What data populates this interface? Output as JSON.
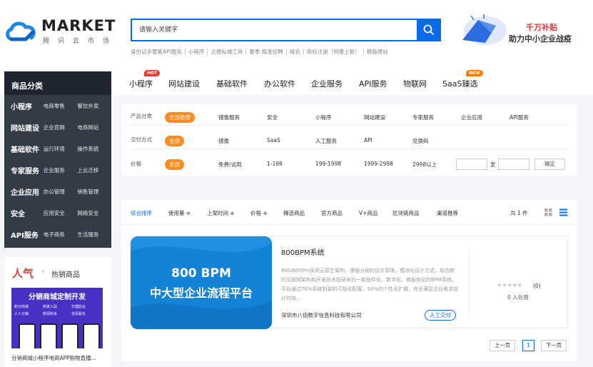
{
  "logo": {
    "main": "MARKET",
    "sub": "腾讯云市场"
  },
  "search": {
    "placeholder": "请输入关键字",
    "value": ""
  },
  "hotkeys": [
    "身份证多要素API服务",
    "小程序",
    "企微私域工具",
    "春季·精准招聘",
    "域名",
    "商标注册（特惠上新）",
    "模版建站"
  ],
  "promo": {
    "line1": "千万补贴",
    "line2": "助力中小企业战疫"
  },
  "nav": {
    "items": [
      {
        "label": "小程序",
        "badge": "HOT"
      },
      {
        "label": "网站建设",
        "badge": ""
      },
      {
        "label": "基础软件",
        "badge": ""
      },
      {
        "label": "办公软件",
        "badge": ""
      },
      {
        "label": "企业服务",
        "badge": ""
      },
      {
        "label": "API服务",
        "badge": ""
      },
      {
        "label": "物联网",
        "badge": ""
      },
      {
        "label": "SaaS臻选",
        "badge": "NEW"
      }
    ]
  },
  "sidebar": {
    "title": "商品分类",
    "rows": [
      {
        "cat": "小程序",
        "sub1": "电商零售",
        "sub2": "餐饮外卖"
      },
      {
        "cat": "网站建设",
        "sub1": "企业官网",
        "sub2": "电商网站"
      },
      {
        "cat": "基础软件",
        "sub1": "运行环境",
        "sub2": "操作系统"
      },
      {
        "cat": "专家服务",
        "sub1": "企业服务",
        "sub2": "上云迁移"
      },
      {
        "cat": "企业应用",
        "sub1": "办公管理",
        "sub2": "销售管理"
      },
      {
        "cat": "安全",
        "sub1": "应用安全",
        "sub2": "网络安全"
      },
      {
        "cat": "API服务",
        "sub1": "电子商务",
        "sub2": "生活服务"
      }
    ]
  },
  "hot": {
    "title": "人气",
    "sep": "·",
    "subtitle": "热销商品",
    "banner_title": "分销商城定制开发",
    "banner_tags": [
      "积分商城",
      "商家入驻",
      "代理后台",
      "人人分销",
      "拼团秒杀",
      "全民股东"
    ],
    "caption": "分销商城小程序电商APP购物直播..."
  },
  "filter": {
    "rows": [
      {
        "label": "产品分类",
        "active": "全部类型",
        "options": [
          "镜像服务",
          "安全",
          "小程序",
          "网站建设",
          "专家服务",
          "企业应用",
          "API服务"
        ]
      },
      {
        "label": "交付方式",
        "active": "全部",
        "options": [
          "镜像",
          "SaaS",
          "人工服务",
          "API",
          "兑换码"
        ]
      },
      {
        "label": "价格",
        "active": "全部",
        "options": [
          "免费/试用",
          "1-198",
          "199-1998",
          "1999-2998",
          "2998以上"
        ]
      }
    ],
    "price_to": "至",
    "confirm": "确定"
  },
  "sort": {
    "items": [
      "综合排序",
      "使用量 ≑",
      "上架时间 ≑",
      "价格 ≑",
      "臻选商品",
      "官方商品",
      "V+商品",
      "区块链商品",
      "渠道推荐"
    ],
    "count": "共 1 件"
  },
  "product": {
    "image_line1": "800 BPM",
    "image_line2": "中大型企业流程平台",
    "title": "800BPM系统",
    "desc": "800/800Pro采用云原生架构，遵循分层的设计原理，模块化设计方式，结合新的互联网架构和开发技术而研发的一款插件化、数字化、微服务化的BPM系统。平台通过70%系统封装的可视化配置，30%的个性化扩展，完全满足企业需求设计时规...",
    "company": "深圳市八佰数字信息科技有限公司",
    "tag": "人工交付",
    "stars": "★★★★★",
    "rating": "(0)",
    "users": "0 人在用"
  },
  "pager": {
    "prev": "上一页",
    "current": "1",
    "next": "下一页"
  },
  "colors": {
    "accent": "#0a6be8",
    "orange": "#ff8a1f",
    "red": "#e53935",
    "sidebar": "#333b46"
  }
}
